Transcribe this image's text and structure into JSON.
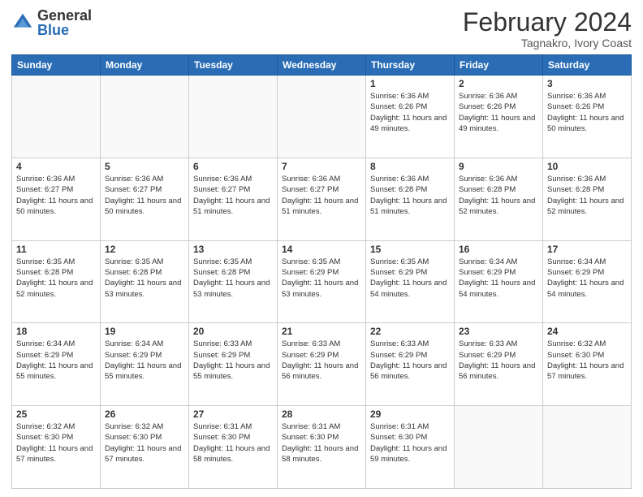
{
  "header": {
    "logo_general": "General",
    "logo_blue": "Blue",
    "title": "February 2024",
    "subtitle": "Tagnakro, Ivory Coast"
  },
  "days_of_week": [
    "Sunday",
    "Monday",
    "Tuesday",
    "Wednesday",
    "Thursday",
    "Friday",
    "Saturday"
  ],
  "weeks": [
    [
      {
        "day": "",
        "info": ""
      },
      {
        "day": "",
        "info": ""
      },
      {
        "day": "",
        "info": ""
      },
      {
        "day": "",
        "info": ""
      },
      {
        "day": "1",
        "info": "Sunrise: 6:36 AM\nSunset: 6:26 PM\nDaylight: 11 hours and 49 minutes."
      },
      {
        "day": "2",
        "info": "Sunrise: 6:36 AM\nSunset: 6:26 PM\nDaylight: 11 hours and 49 minutes."
      },
      {
        "day": "3",
        "info": "Sunrise: 6:36 AM\nSunset: 6:26 PM\nDaylight: 11 hours and 50 minutes."
      }
    ],
    [
      {
        "day": "4",
        "info": "Sunrise: 6:36 AM\nSunset: 6:27 PM\nDaylight: 11 hours and 50 minutes."
      },
      {
        "day": "5",
        "info": "Sunrise: 6:36 AM\nSunset: 6:27 PM\nDaylight: 11 hours and 50 minutes."
      },
      {
        "day": "6",
        "info": "Sunrise: 6:36 AM\nSunset: 6:27 PM\nDaylight: 11 hours and 51 minutes."
      },
      {
        "day": "7",
        "info": "Sunrise: 6:36 AM\nSunset: 6:27 PM\nDaylight: 11 hours and 51 minutes."
      },
      {
        "day": "8",
        "info": "Sunrise: 6:36 AM\nSunset: 6:28 PM\nDaylight: 11 hours and 51 minutes."
      },
      {
        "day": "9",
        "info": "Sunrise: 6:36 AM\nSunset: 6:28 PM\nDaylight: 11 hours and 52 minutes."
      },
      {
        "day": "10",
        "info": "Sunrise: 6:36 AM\nSunset: 6:28 PM\nDaylight: 11 hours and 52 minutes."
      }
    ],
    [
      {
        "day": "11",
        "info": "Sunrise: 6:35 AM\nSunset: 6:28 PM\nDaylight: 11 hours and 52 minutes."
      },
      {
        "day": "12",
        "info": "Sunrise: 6:35 AM\nSunset: 6:28 PM\nDaylight: 11 hours and 53 minutes."
      },
      {
        "day": "13",
        "info": "Sunrise: 6:35 AM\nSunset: 6:28 PM\nDaylight: 11 hours and 53 minutes."
      },
      {
        "day": "14",
        "info": "Sunrise: 6:35 AM\nSunset: 6:29 PM\nDaylight: 11 hours and 53 minutes."
      },
      {
        "day": "15",
        "info": "Sunrise: 6:35 AM\nSunset: 6:29 PM\nDaylight: 11 hours and 54 minutes."
      },
      {
        "day": "16",
        "info": "Sunrise: 6:34 AM\nSunset: 6:29 PM\nDaylight: 11 hours and 54 minutes."
      },
      {
        "day": "17",
        "info": "Sunrise: 6:34 AM\nSunset: 6:29 PM\nDaylight: 11 hours and 54 minutes."
      }
    ],
    [
      {
        "day": "18",
        "info": "Sunrise: 6:34 AM\nSunset: 6:29 PM\nDaylight: 11 hours and 55 minutes."
      },
      {
        "day": "19",
        "info": "Sunrise: 6:34 AM\nSunset: 6:29 PM\nDaylight: 11 hours and 55 minutes."
      },
      {
        "day": "20",
        "info": "Sunrise: 6:33 AM\nSunset: 6:29 PM\nDaylight: 11 hours and 55 minutes."
      },
      {
        "day": "21",
        "info": "Sunrise: 6:33 AM\nSunset: 6:29 PM\nDaylight: 11 hours and 56 minutes."
      },
      {
        "day": "22",
        "info": "Sunrise: 6:33 AM\nSunset: 6:29 PM\nDaylight: 11 hours and 56 minutes."
      },
      {
        "day": "23",
        "info": "Sunrise: 6:33 AM\nSunset: 6:29 PM\nDaylight: 11 hours and 56 minutes."
      },
      {
        "day": "24",
        "info": "Sunrise: 6:32 AM\nSunset: 6:30 PM\nDaylight: 11 hours and 57 minutes."
      }
    ],
    [
      {
        "day": "25",
        "info": "Sunrise: 6:32 AM\nSunset: 6:30 PM\nDaylight: 11 hours and 57 minutes."
      },
      {
        "day": "26",
        "info": "Sunrise: 6:32 AM\nSunset: 6:30 PM\nDaylight: 11 hours and 57 minutes."
      },
      {
        "day": "27",
        "info": "Sunrise: 6:31 AM\nSunset: 6:30 PM\nDaylight: 11 hours and 58 minutes."
      },
      {
        "day": "28",
        "info": "Sunrise: 6:31 AM\nSunset: 6:30 PM\nDaylight: 11 hours and 58 minutes."
      },
      {
        "day": "29",
        "info": "Sunrise: 6:31 AM\nSunset: 6:30 PM\nDaylight: 11 hours and 59 minutes."
      },
      {
        "day": "",
        "info": ""
      },
      {
        "day": "",
        "info": ""
      }
    ]
  ]
}
